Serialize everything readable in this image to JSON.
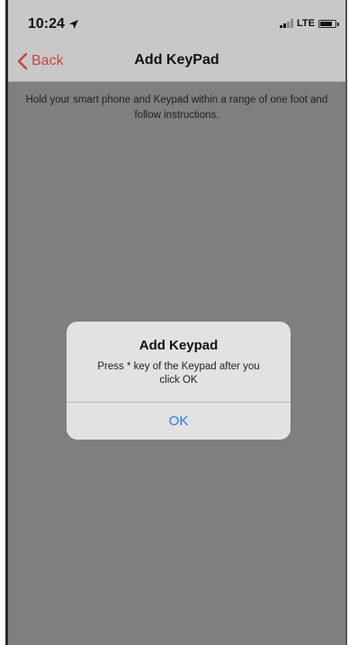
{
  "status_bar": {
    "time": "10:24",
    "network": "LTE"
  },
  "nav": {
    "back_label": "Back",
    "title": "Add KeyPad"
  },
  "instructions": {
    "line1": "Hold your smart phone and Keypad within a range of one foot and",
    "line2": "follow instructions."
  },
  "alert": {
    "title": "Add Keypad",
    "message_line1": "Press * key of the Keypad after you",
    "message_line2": "click OK",
    "ok_label": "OK"
  },
  "colors": {
    "accent_red": "#c8453f",
    "link_blue": "#2d7be0",
    "overlay_gray": "#7f7f7f"
  }
}
